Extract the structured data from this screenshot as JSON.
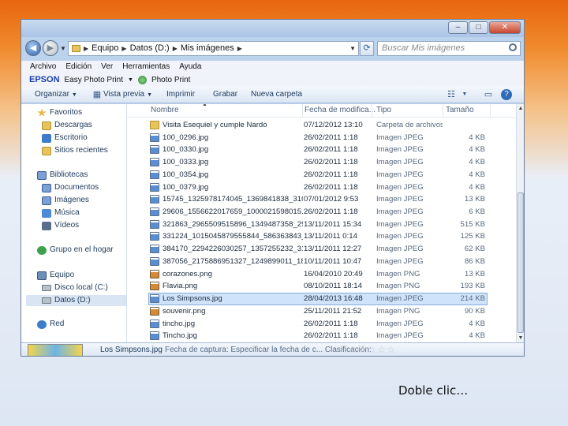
{
  "window": {
    "buttons": {
      "minimize": "–",
      "maximize": "□",
      "close": "✕"
    }
  },
  "address": {
    "back_icon": "arrow-left-icon",
    "forward_icon": "arrow-right-icon",
    "path": [
      "Equipo",
      "Datos (D:)",
      "Mis imágenes"
    ],
    "refresh_icon": "refresh-icon",
    "search_placeholder": "Buscar Mis imágenes"
  },
  "menubar": [
    "Archivo",
    "Edición",
    "Ver",
    "Herramientas",
    "Ayuda"
  ],
  "epson": {
    "logo": "EPSON",
    "easy_photo_print": "Easy Photo Print",
    "photo_print": "Photo Print"
  },
  "toolbar": {
    "organize": "Organizar",
    "preview": "Vista previa",
    "print": "Imprimir",
    "burn": "Grabar",
    "new_folder": "Nueva carpeta"
  },
  "navpane": {
    "favorites": "Favoritos",
    "downloads": "Descargas",
    "desktop": "Escritorio",
    "recent": "Sitios recientes",
    "libraries": "Bibliotecas",
    "documents": "Documentos",
    "images": "Imágenes",
    "music": "Música",
    "videos": "Vídeos",
    "homegroup": "Grupo en el hogar",
    "computer": "Equipo",
    "local_disk": "Disco local (C:)",
    "data_disk": "Datos (D:)",
    "network": "Red"
  },
  "columns": {
    "name": "Nombre",
    "date": "Fecha de modifica...",
    "type": "Tipo",
    "size": "Tamaño"
  },
  "files": [
    {
      "name": "Visita Esequiel y cumple Nardo",
      "date": "07/12/2012 13:10",
      "type": "Carpeta de archivos",
      "size": "",
      "kind": "folder"
    },
    {
      "name": "100_0296.jpg",
      "date": "26/02/2011 1:18",
      "type": "Imagen JPEG",
      "size": "4 KB",
      "kind": "jpeg"
    },
    {
      "name": "100_0330.jpg",
      "date": "26/02/2011 1:18",
      "type": "Imagen JPEG",
      "size": "4 KB",
      "kind": "jpeg"
    },
    {
      "name": "100_0333.jpg",
      "date": "26/02/2011 1:18",
      "type": "Imagen JPEG",
      "size": "4 KB",
      "kind": "jpeg"
    },
    {
      "name": "100_0354.jpg",
      "date": "26/02/2011 1:18",
      "type": "Imagen JPEG",
      "size": "4 KB",
      "kind": "jpeg"
    },
    {
      "name": "100_0379.jpg",
      "date": "26/02/2011 1:18",
      "type": "Imagen JPEG",
      "size": "4 KB",
      "kind": "jpeg"
    },
    {
      "name": "15745_1325978174045_1369841838_31088...",
      "date": "07/01/2012 9:53",
      "type": "Imagen JPEG",
      "size": "13 KB",
      "kind": "jpeg"
    },
    {
      "name": "29606_1556622017659_1000021598015...",
      "date": "26/02/2011 1:18",
      "type": "Imagen JPEG",
      "size": "6 KB",
      "kind": "jpeg"
    },
    {
      "name": "321863_2965509515896_1349487358_2940...",
      "date": "13/11/2011 15:34",
      "type": "Imagen JPEG",
      "size": "515 KB",
      "kind": "jpeg"
    },
    {
      "name": "331224_1015045879555844_586363843_1...",
      "date": "13/11/2011 0:14",
      "type": "Imagen JPEG",
      "size": "125 KB",
      "kind": "jpeg"
    },
    {
      "name": "384170_2294226030257_1357255232_3196...",
      "date": "13/11/2011 12:27",
      "type": "Imagen JPEG",
      "size": "62 KB",
      "kind": "jpeg"
    },
    {
      "name": "387056_2175886951327_1249899011_1888...",
      "date": "10/11/2011 10:47",
      "type": "Imagen JPEG",
      "size": "86 KB",
      "kind": "jpeg"
    },
    {
      "name": "corazones.png",
      "date": "16/04/2010 20:49",
      "type": "Imagen PNG",
      "size": "13 KB",
      "kind": "png"
    },
    {
      "name": "Flavia.png",
      "date": "08/10/2011 18:14",
      "type": "Imagen PNG",
      "size": "193 KB",
      "kind": "png"
    },
    {
      "name": "Los Simpsons.jpg",
      "date": "28/04/2013 16:48",
      "type": "Imagen JPEG",
      "size": "214 KB",
      "kind": "jpeg",
      "selected": true
    },
    {
      "name": "souvenir.png",
      "date": "25/11/2011 21:52",
      "type": "Imagen PNG",
      "size": "90 KB",
      "kind": "png"
    },
    {
      "name": "tincho.jpg",
      "date": "26/02/2011 1:18",
      "type": "Imagen JPEG",
      "size": "4 KB",
      "kind": "jpeg"
    },
    {
      "name": "Tincho.jpg",
      "date": "26/02/2011 1:18",
      "type": "Imagen JPEG",
      "size": "4 KB",
      "kind": "jpeg"
    }
  ],
  "details": {
    "filename": "Los Simpsons.jpg",
    "properties": "Fecha de captura: Especificar la fecha de c... Clasificación:",
    "stars": "☆☆☆☆☆"
  },
  "caption": "Doble clic…"
}
